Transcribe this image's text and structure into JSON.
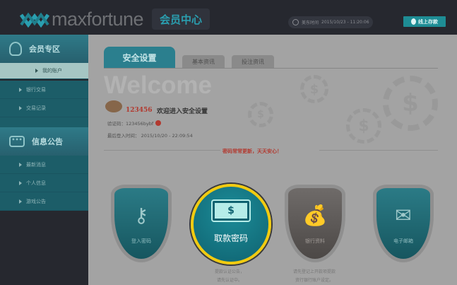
{
  "header": {
    "logo": "maxfortune",
    "title": "会员中心",
    "time_label": "美东时间",
    "time": "2015/10/23 - 11:20:06",
    "online_button": "线上存款"
  },
  "sidebar": {
    "sections": [
      {
        "title": "会员专区",
        "icon": "user-icon",
        "items": [
          {
            "label": "我的账户",
            "active": true
          },
          {
            "label": "银行交易"
          },
          {
            "label": "交易记录"
          }
        ]
      },
      {
        "title": "信息公告",
        "icon": "chat-icon",
        "items": [
          {
            "label": "最新消息"
          },
          {
            "label": "个人信息"
          },
          {
            "label": "游戏公告"
          }
        ]
      }
    ]
  },
  "main": {
    "tabs": [
      {
        "label": "安全设置",
        "active": true
      },
      {
        "label": "基本资讯"
      },
      {
        "label": "投注资讯"
      }
    ],
    "welcome": "Welcome",
    "user_id": "123456",
    "welcome_text": "欢迎进入安全设置",
    "verify_label": "验证码：123456bybf",
    "last_login": "最后登入时间：  2015/10/20 - 22:09:54",
    "slogan": "密码常常更新，天天安心！",
    "cards": [
      {
        "label": "登入密码",
        "icon": "key-icon",
        "color": "#1f6f7a"
      },
      {
        "label": "取款密码",
        "icon": "money-icon",
        "highlighted": true,
        "highlight_color": "#f1cb10",
        "note": [
          "提款认证公告，",
          "请先认证中。"
        ]
      },
      {
        "label": "银行资料",
        "icon": "money-bags-icon",
        "color": "#5e5a58",
        "note": [
          "请先登记上开款项提款",
          "资行银行账户设定。"
        ]
      },
      {
        "label": "电子邮箱",
        "icon": "envelope-icon",
        "color": "#1f6f7a"
      }
    ]
  }
}
